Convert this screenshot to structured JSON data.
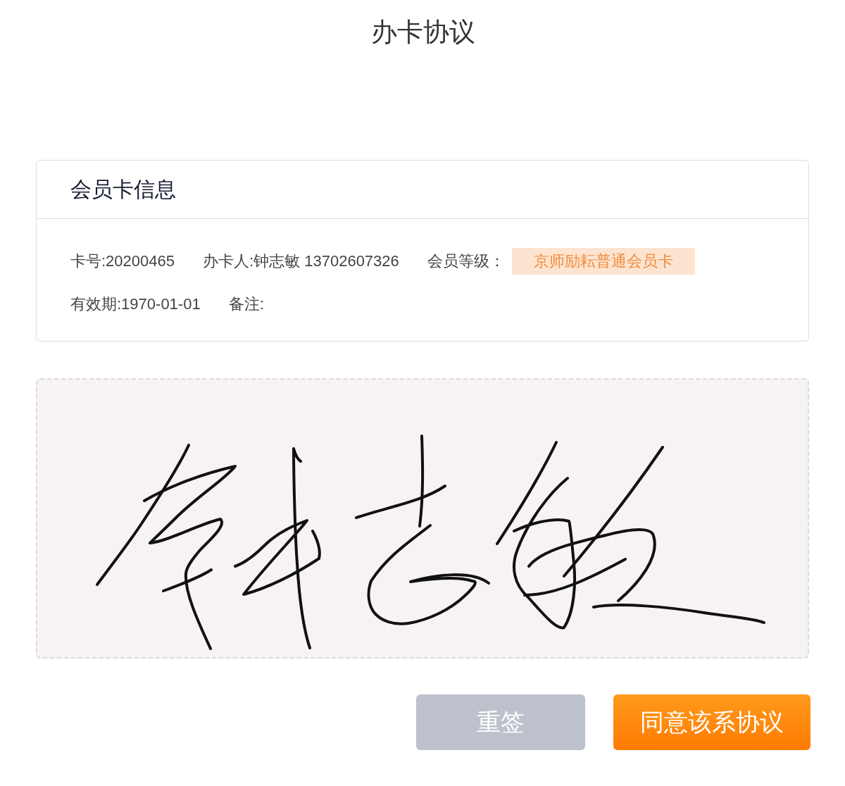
{
  "title": "办卡协议",
  "card": {
    "title": "会员卡信息",
    "rows": [
      [
        {
          "label": "卡号:20200465"
        },
        {
          "label": "办卡人:钟志敏 13702607326"
        },
        {
          "label": "会员等级：",
          "badge": "京师励耘普通会员卡"
        }
      ],
      [
        {
          "label": "有效期:1970-01-01"
        },
        {
          "label": "备注:"
        }
      ]
    ]
  },
  "signature_pad": {
    "signed": true
  },
  "buttons": [
    {
      "label": "重签",
      "kind": "secondary"
    },
    {
      "label": "同意该系协议",
      "kind": "primary"
    }
  ]
}
